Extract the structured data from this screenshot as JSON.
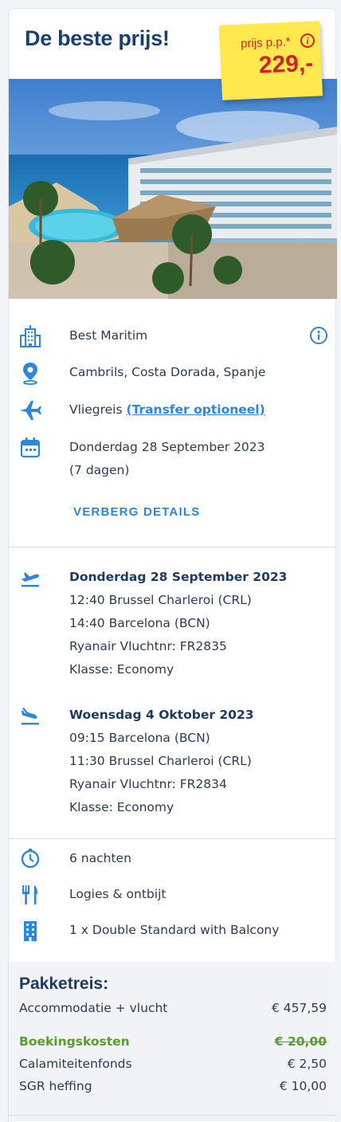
{
  "header": {
    "title": "De beste prijs!",
    "price_label": "prijs p.p.*",
    "price_value": "229,-"
  },
  "hotel": {
    "name": "Best Maritim",
    "location": "Cambrils, Costa Dorada, Spanje",
    "travel_type": "Vliegreis",
    "transfer_link": "(Transfer optioneel)",
    "date": "Donderdag 28 September 2023",
    "duration": "(7 dagen)",
    "toggle_details": "VERBERG DETAILS"
  },
  "flights": [
    {
      "date": "Donderdag 28 September 2023",
      "depart": "12:40 Brussel Charleroi (CRL)",
      "arrive": "14:40 Barcelona (BCN)",
      "carrier": "Ryanair Vluchtnr: FR2835",
      "class": "Klasse: Economy"
    },
    {
      "date": "Woensdag 4 Oktober 2023",
      "depart": "09:15 Barcelona (BCN)",
      "arrive": "11:30 Brussel Charleroi (CRL)",
      "carrier": "Ryanair Vluchtnr: FR2834",
      "class": "Klasse: Economy"
    }
  ],
  "extras": {
    "nights": "6 nachten",
    "board": "Logies & ontbijt",
    "room": "1 x Double Standard with Balcony"
  },
  "pricing": {
    "title": "Pakketreis:",
    "rows": [
      {
        "label": "Accommodatie + vlucht",
        "value": "€ 457,59"
      },
      {
        "label": "Boekingskosten",
        "value": "€ 20,00"
      },
      {
        "label": "Calamiteitenfonds",
        "value": "€ 2,50"
      },
      {
        "label": "SGR heffing",
        "value": "€ 10,00"
      }
    ]
  },
  "colors": {
    "accent": "#2f86d6",
    "title": "#1b3f6e",
    "price_red": "#d52027",
    "sticky_yellow": "#ffe94f",
    "discount_green": "#5a9d2a"
  },
  "icons": [
    "building-icon",
    "map-pin-icon",
    "plane-icon",
    "calendar-icon",
    "info-icon",
    "plane-departure-icon",
    "plane-arrival-icon",
    "timer-icon",
    "cutlery-icon",
    "room-building-icon"
  ]
}
